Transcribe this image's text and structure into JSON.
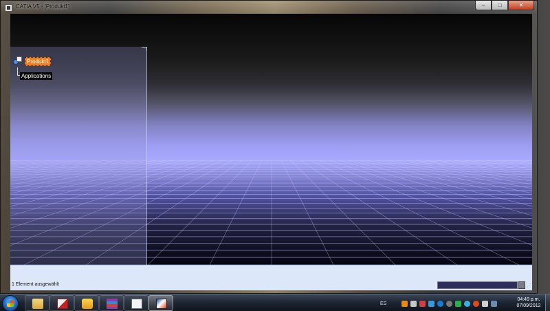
{
  "window": {
    "title": "CATIA V5 - [Produkt1]",
    "minimize_glyph": "–",
    "maximize_glyph": "□",
    "close_glyph": "✕"
  },
  "tree": {
    "root_label": "Produkt1",
    "root_icon": "product-icon",
    "children": [
      {
        "label": "Applications"
      }
    ]
  },
  "status": {
    "message": "1 Element ausgewählt",
    "command_value": ""
  },
  "taskbar": {
    "apps": [
      {
        "name": "explorer",
        "icon": "folder-icon"
      },
      {
        "name": "pdf-reader",
        "icon": "pdf-icon"
      },
      {
        "name": "mail",
        "icon": "envelope-icon"
      },
      {
        "name": "archive",
        "icon": "archive-icon"
      },
      {
        "name": "notepad",
        "icon": "notepad-icon"
      },
      {
        "name": "catia",
        "icon": "catia-icon",
        "active": true
      }
    ],
    "tray": {
      "language": "ES",
      "icons": [
        "flash-icon",
        "print-icon",
        "flag-icon",
        "antivirus-icon",
        "search-icon",
        "update-icon",
        "network-icon",
        "sync-icon",
        "alert-icon",
        "speaker-icon",
        "monitor-icon"
      ]
    },
    "clock": {
      "time": "04:49 p.m.",
      "date": "07/09/2012"
    }
  },
  "colors": {
    "tree_highlight": "#f07f1e",
    "status_bg": "#dde7fa",
    "grid_line": "#c8c8ff"
  }
}
